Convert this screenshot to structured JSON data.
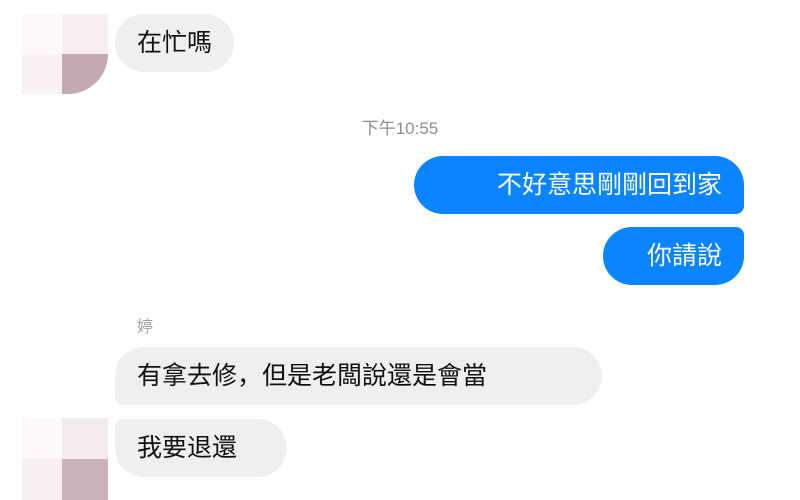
{
  "colors": {
    "incoming_bubble": "#efeff1",
    "outgoing_bubble": "#0a84ff",
    "outgoing_text": "#ffffff",
    "meta_text": "#8e8e93"
  },
  "icons": {
    "avatar": "pixelated-avatar-icon"
  },
  "chat": {
    "messages_top": [
      {
        "text": "在忙嗎"
      }
    ],
    "timestamp": "下午10:55",
    "outgoing": [
      {
        "text": "不好意思剛剛回到家"
      },
      {
        "text": "你請說"
      }
    ],
    "sender_name": "婷",
    "incoming": [
      {
        "text": "有拿去修，但是老闆說還是會當"
      },
      {
        "text": "我要退還"
      }
    ]
  }
}
